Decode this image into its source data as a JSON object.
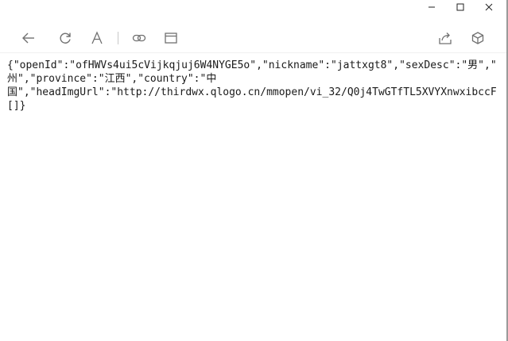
{
  "window": {
    "caption": {
      "minimize_icon": "minimize-icon",
      "maximize_icon": "maximize-icon",
      "close_icon": "close-icon"
    }
  },
  "toolbar": {
    "icons": [
      "back-arrow-icon",
      "refresh-icon",
      "text-size-icon",
      "link-icon",
      "browser-window-icon",
      "share-icon",
      "cube-icon"
    ]
  },
  "content": {
    "lines": [
      "{\"openId\":\"ofHWVs4ui5cVijkqjuj6W4NYGE5o\",\"nickname\":\"jattxgt8\",\"sexDesc\":\"男\",\"",
      "州\",\"province\":\"江西\",\"country\":\"中",
      "国\",\"headImgUrl\":\"http://thirdwx.qlogo.cn/mmopen/vi_32/Q0j4TwGTfTL5XVYXnwxibccF",
      "[]}"
    ]
  },
  "colors": {
    "background": "#ffffff",
    "text": "#1a1a1a",
    "toolbar_icon": "#707070"
  }
}
